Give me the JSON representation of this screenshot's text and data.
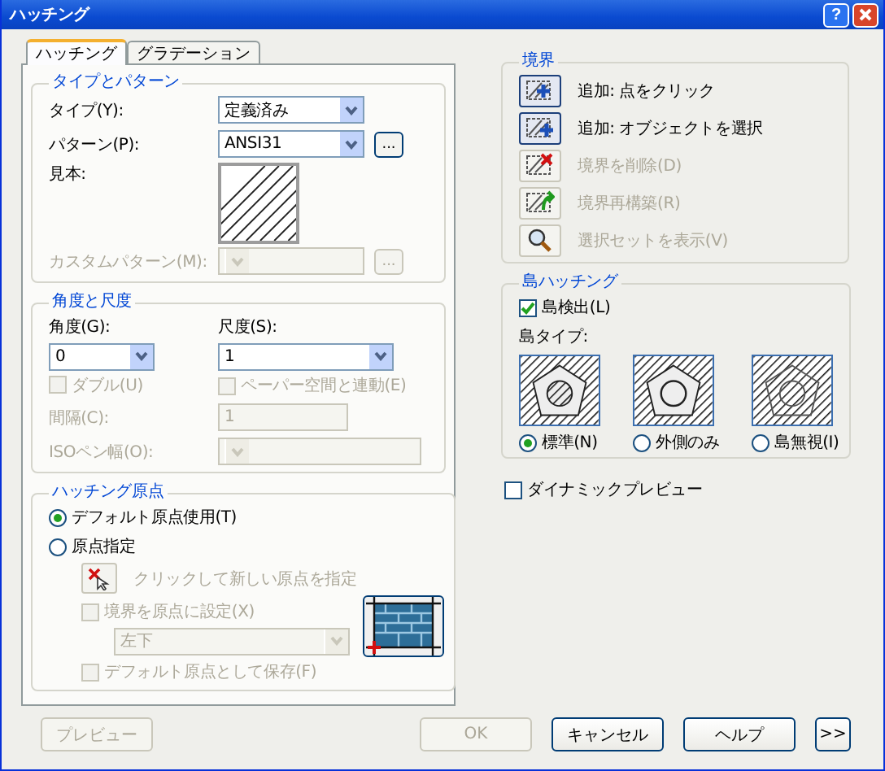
{
  "window": {
    "title": "ハッチング",
    "help": "?"
  },
  "tabs": [
    {
      "label": "ハッチング",
      "selected": true
    },
    {
      "label": "グラデーション",
      "selected": false
    }
  ],
  "type_pattern": {
    "title": "タイプとパターン",
    "fields": [
      {
        "kind": "dropdown",
        "label": "タイプ(Y):",
        "value": "定義済み",
        "disabled": false
      },
      {
        "kind": "dropdown",
        "label": "パターン(P):",
        "value": "ANSI31",
        "disabled": false,
        "browse": "..."
      },
      {
        "kind": "swatch",
        "label": "見本:"
      },
      {
        "kind": "dropdown",
        "label": "カスタムパターン(M):",
        "disabled": true,
        "browse": "..."
      }
    ]
  },
  "angle_scale": {
    "title": "角度と尺度",
    "angle": {
      "label": "角度(G):",
      "value": "0",
      "disabled": false
    },
    "scale": {
      "label": "尺度(S):",
      "value": "1",
      "disabled": false
    },
    "double": {
      "label": "ダブル(U)",
      "checked": false,
      "disabled": true
    },
    "paper": {
      "label": "ペーパー空間と連動(E)",
      "checked": false,
      "disabled": true
    },
    "spacing": {
      "label": "間隔(C):",
      "value": "1",
      "disabled": true
    },
    "pen_width": {
      "label": "ISOペン幅(O):",
      "disabled": true
    }
  },
  "origin": {
    "title": "ハッチング原点",
    "options": [
      {
        "label": "デフォルト原点使用(T)",
        "selected": true
      },
      {
        "label": "原点指定",
        "selected": false
      }
    ],
    "click_label": "クリックして新しい原点を指定",
    "disabled": true,
    "set_boundary": {
      "label": "境界を原点に設定(X)",
      "checked": false,
      "disabled": true
    },
    "position": {
      "value": "左下",
      "disabled": true
    },
    "save_default": {
      "label": "デフォルト原点として保存(F)",
      "checked": false,
      "disabled": true
    }
  },
  "boundary": {
    "title": "境界",
    "actions": [
      {
        "kind": "pick_point",
        "label": "追加: 点をクリック",
        "disabled": false
      },
      {
        "kind": "select_objects",
        "label": "追加: オブジェクトを選択",
        "disabled": false
      },
      {
        "kind": "remove",
        "label": "境界を削除(D)",
        "disabled": true
      },
      {
        "kind": "recreate",
        "label": "境界再構築(R)",
        "disabled": true
      },
      {
        "kind": "view",
        "label": "選択セットを表示(V)",
        "disabled": true
      }
    ]
  },
  "island": {
    "title": "島ハッチング",
    "detect": {
      "label": "島検出(L)",
      "checked": true,
      "disabled": false
    },
    "type_label": "島タイプ:",
    "styles": [
      {
        "kind": "normal",
        "label": "標準(N)",
        "selected": true
      },
      {
        "kind": "outer",
        "label": "外側のみ",
        "selected": false
      },
      {
        "kind": "ignore",
        "label": "島無視(I)",
        "selected": false
      }
    ]
  },
  "dynamic_preview": {
    "label": "ダイナミックプレビュー",
    "checked": false,
    "disabled": false
  },
  "buttons": [
    {
      "label": "プレビュー",
      "disabled": true
    },
    {
      "label": "OK",
      "disabled": true
    },
    {
      "label": "キャンセル",
      "disabled": false
    },
    {
      "label": "ヘルプ",
      "disabled": false
    },
    {
      "label": ">>",
      "disabled": false
    }
  ]
}
